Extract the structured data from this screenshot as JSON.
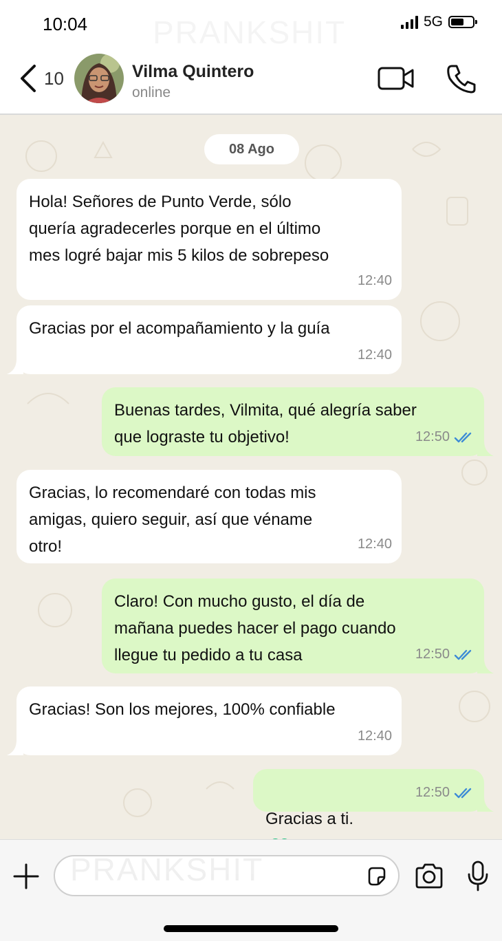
{
  "status_bar": {
    "time": "10:04",
    "network": "5G",
    "watermark": "PRANKSHIT"
  },
  "header": {
    "back_count": "10",
    "contact_name": "Vilma Quintero",
    "contact_status": "online"
  },
  "chat": {
    "date": "08 Ago",
    "messages": [
      {
        "direction": "in",
        "text": "Hola! Señores de Punto Verde, sólo\nquería agradecerles porque en el último\nmes logré bajar mis 5 kilos de sobrepeso",
        "time": "12:40"
      },
      {
        "direction": "in",
        "text": "Gracias por el acompañamiento y la guía",
        "time": "12:40"
      },
      {
        "direction": "out",
        "text": "Buenas tardes, Vilmita, qué alegría saber\nque lograste tu objetivo!",
        "time": "12:50",
        "read": true
      },
      {
        "direction": "in",
        "text": "Gracias, lo recomendaré con todas mis\namigas, quiero seguir, así que véname\notro!",
        "time": "12:40"
      },
      {
        "direction": "out",
        "text": "Claro! Con mucho gusto, el día de\nmañana puedes hacer el pago cuando\nllegue tu pedido a tu casa",
        "time": "12:50",
        "read": true
      },
      {
        "direction": "in",
        "text": "Gracias! Son los mejores, 100% confiable",
        "time": "12:40"
      },
      {
        "direction": "out",
        "text": "Gracias a ti.",
        "emoji": "green-heart",
        "time": "12:50",
        "read": true
      }
    ]
  },
  "composer": {
    "placeholder": "PRANKSHIT"
  },
  "colors": {
    "incoming_bubble": "#ffffff",
    "outgoing_bubble": "#dcf8c6",
    "chat_background": "#f1ede4",
    "read_ticks": "#3d8bd6",
    "heart": "#19c37d"
  }
}
